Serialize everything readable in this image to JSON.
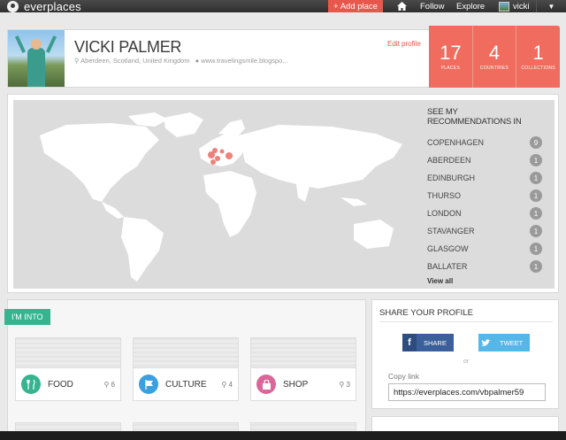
{
  "nav": {
    "logo": "everplaces",
    "add_place": "+ Add place",
    "home_icon": "home-icon",
    "follow": "Follow",
    "explore": "Explore",
    "user": "vicki",
    "caret": "▼"
  },
  "profile": {
    "name": "VICKI PALMER",
    "location": "Aberdeen, Scotland, United Kingdom",
    "website": "www.travelingsmile.blogspo...",
    "edit": "Edit profile",
    "stats": [
      {
        "num": "17",
        "label": "PLACES"
      },
      {
        "num": "4",
        "label": "COUNTRIES"
      },
      {
        "num": "1",
        "label": "COLLECTIONS"
      }
    ]
  },
  "recommendations": {
    "title": "SEE MY RECOMMENDATIONS IN",
    "items": [
      {
        "city": "COPENHAGEN",
        "count": "9"
      },
      {
        "city": "ABERDEEN",
        "count": "1"
      },
      {
        "city": "EDINBURGH",
        "count": "1"
      },
      {
        "city": "THURSO",
        "count": "1"
      },
      {
        "city": "LONDON",
        "count": "1"
      },
      {
        "city": "STAVANGER",
        "count": "1"
      },
      {
        "city": "GLASGOW",
        "count": "1"
      },
      {
        "city": "BALLATER",
        "count": "1"
      }
    ],
    "view_all": "View all"
  },
  "into": {
    "title": "I'M INTO",
    "tiles": [
      {
        "label": "FOOD",
        "count": "6",
        "color": "#35b48f",
        "icon": "fork-knife-icon"
      },
      {
        "label": "CULTURE",
        "count": "4",
        "color": "#3b9fe0",
        "icon": "flag-icon"
      },
      {
        "label": "SHOP",
        "count": "3",
        "color": "#d9679a",
        "icon": "shopping-bag-icon"
      }
    ]
  },
  "share": {
    "title": "SHARE YOUR PROFILE",
    "facebook": "SHARE",
    "twitter": "TWEET",
    "or": "or",
    "copy_label": "Copy link",
    "copy_value": "https://everplaces.com/vbpalmer59"
  },
  "colors": {
    "accent": "#e8574c",
    "stats_bg": "#f06c5e",
    "map_land": "#ffffff",
    "map_bg": "#dcdcdc",
    "marker": "#e8574c"
  }
}
